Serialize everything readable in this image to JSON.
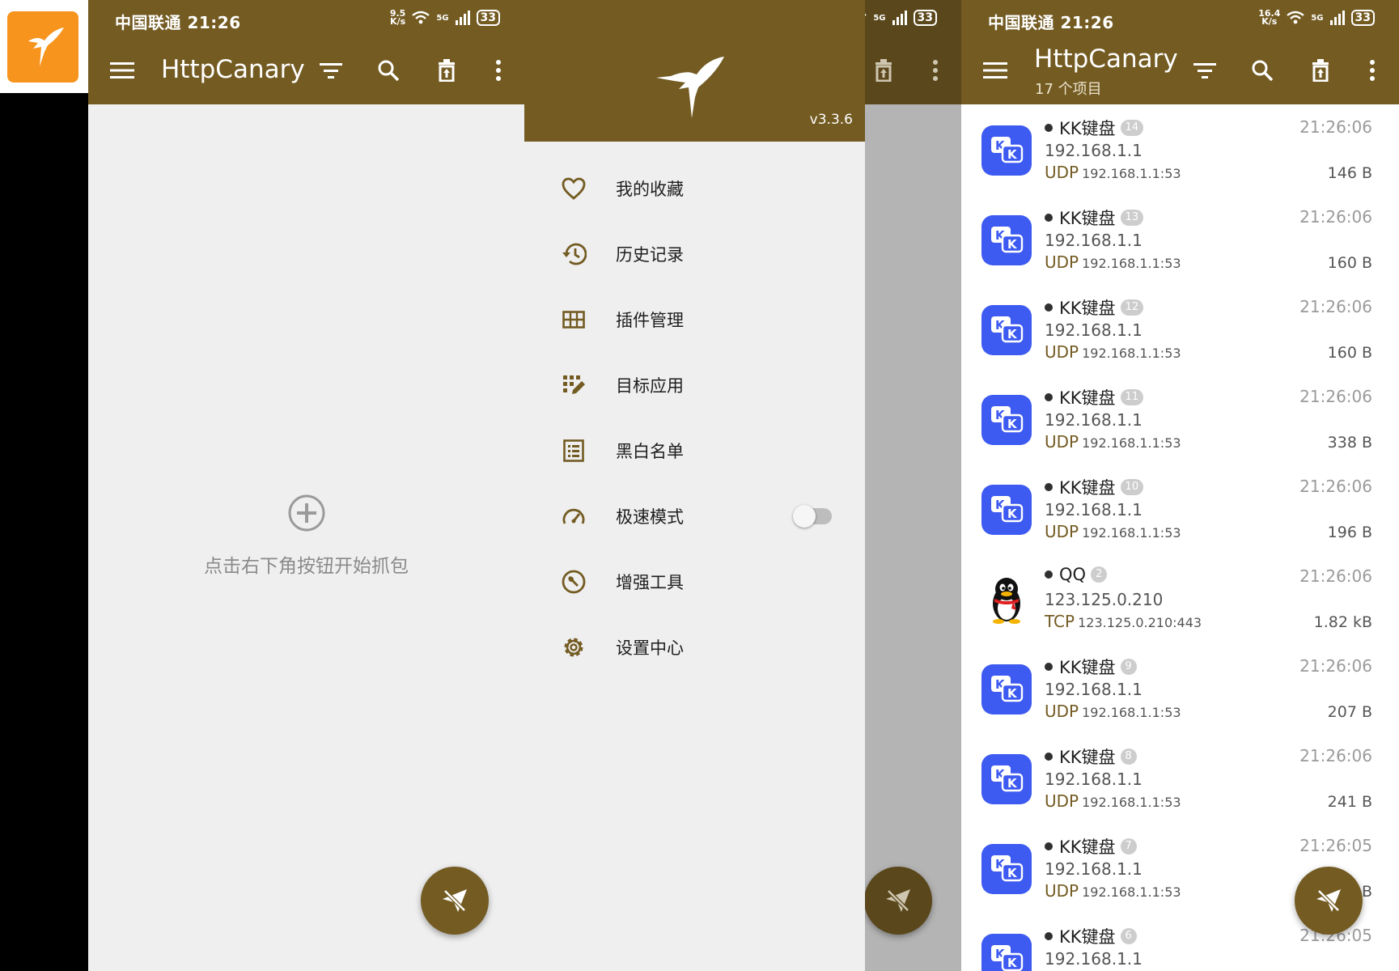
{
  "status": {
    "carrier_time": "中国联通 21:26",
    "net_speed_1": "9.5\nK/s",
    "net_speed_3": "16.4\nK/s",
    "sig_5g": "5G",
    "battery": "33"
  },
  "panel_main": {
    "title": "HttpCanary",
    "empty_text": "点击右下角按钮开始抓包"
  },
  "drawer": {
    "version": "v3.3.6",
    "items": [
      {
        "label": "我的收藏",
        "icon": "heart-icon"
      },
      {
        "label": "历史记录",
        "icon": "history-icon"
      },
      {
        "label": "插件管理",
        "icon": "grid-icon"
      },
      {
        "label": "目标应用",
        "icon": "target-app-icon"
      },
      {
        "label": "黑白名单",
        "icon": "list-icon"
      },
      {
        "label": "极速模式",
        "icon": "speedometer-icon",
        "toggle": false
      },
      {
        "label": "增强工具",
        "icon": "wrench-icon"
      },
      {
        "label": "设置中心",
        "icon": "gear-icon"
      }
    ]
  },
  "panel_list": {
    "title": "HttpCanary",
    "subtitle": "17 个项目",
    "rows": [
      {
        "app": "KK键盘",
        "count": "14",
        "time": "21:26:06",
        "ip": "192.168.1.1",
        "proto": "UDP",
        "addr": "192.168.1.1:53",
        "size": "146 B",
        "icon": "kk-keyboard-icon"
      },
      {
        "app": "KK键盘",
        "count": "13",
        "time": "21:26:06",
        "ip": "192.168.1.1",
        "proto": "UDP",
        "addr": "192.168.1.1:53",
        "size": "160 B",
        "icon": "kk-keyboard-icon"
      },
      {
        "app": "KK键盘",
        "count": "12",
        "time": "21:26:06",
        "ip": "192.168.1.1",
        "proto": "UDP",
        "addr": "192.168.1.1:53",
        "size": "160 B",
        "icon": "kk-keyboard-icon"
      },
      {
        "app": "KK键盘",
        "count": "11",
        "time": "21:26:06",
        "ip": "192.168.1.1",
        "proto": "UDP",
        "addr": "192.168.1.1:53",
        "size": "338 B",
        "icon": "kk-keyboard-icon"
      },
      {
        "app": "KK键盘",
        "count": "10",
        "time": "21:26:06",
        "ip": "192.168.1.1",
        "proto": "UDP",
        "addr": "192.168.1.1:53",
        "size": "196 B",
        "icon": "kk-keyboard-icon"
      },
      {
        "app": "QQ",
        "count": "2",
        "time": "21:26:06",
        "ip": "123.125.0.210",
        "proto": "TCP",
        "addr": "123.125.0.210:443",
        "size": "1.82 kB",
        "icon": "qq-penguin-icon"
      },
      {
        "app": "KK键盘",
        "count": "9",
        "time": "21:26:06",
        "ip": "192.168.1.1",
        "proto": "UDP",
        "addr": "192.168.1.1:53",
        "size": "207 B",
        "icon": "kk-keyboard-icon"
      },
      {
        "app": "KK键盘",
        "count": "8",
        "time": "21:26:06",
        "ip": "192.168.1.1",
        "proto": "UDP",
        "addr": "192.168.1.1:53",
        "size": "241 B",
        "icon": "kk-keyboard-icon"
      },
      {
        "app": "KK键盘",
        "count": "7",
        "time": "21:26:05",
        "ip": "192.168.1.1",
        "proto": "UDP",
        "addr": "192.168.1.1:53",
        "size": "B",
        "icon": "kk-keyboard-icon"
      },
      {
        "app": "KK键盘",
        "count": "6",
        "time": "21:26:05",
        "ip": "192.168.1.1",
        "proto": "",
        "addr": "",
        "size": "",
        "icon": "kk-keyboard-icon"
      }
    ]
  },
  "colors": {
    "primary": "#735b22",
    "app_icon": "#f7941d",
    "kk_blue": "#3d5af1",
    "drawer_bg": "#efefef"
  }
}
